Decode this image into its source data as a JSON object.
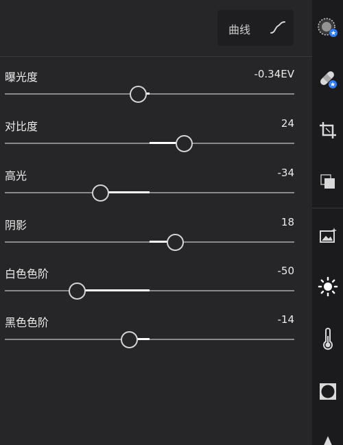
{
  "header": {
    "curve_label": "曲线"
  },
  "sliders": [
    {
      "label": "曝光度",
      "value": "-0.34EV",
      "position": 0.46,
      "center": 0.5
    },
    {
      "label": "对比度",
      "value": "24",
      "position": 0.62,
      "center": 0.5
    },
    {
      "label": "高光",
      "value": "-34",
      "position": 0.33,
      "center": 0.5
    },
    {
      "label": "阴影",
      "value": "18",
      "position": 0.59,
      "center": 0.5
    },
    {
      "label": "白色色阶",
      "value": "-50",
      "position": 0.25,
      "center": 0.5
    },
    {
      "label": "黑色色阶",
      "value": "-14",
      "position": 0.43,
      "center": 0.5
    }
  ],
  "toolbar": {
    "items": [
      {
        "name": "auto-edit-icon"
      },
      {
        "name": "healing-icon"
      },
      {
        "name": "crop-icon"
      },
      {
        "name": "layers-icon"
      },
      {
        "name": "presets-icon"
      },
      {
        "name": "light-icon",
        "active": true
      },
      {
        "name": "color-temperature-icon"
      },
      {
        "name": "vignette-icon"
      },
      {
        "name": "detail-icon"
      }
    ]
  },
  "colors": {
    "panel_bg": "#262628",
    "toolbar_bg": "#1b1b1d",
    "badge_blue": "#2f7cf6",
    "text": "#ececec"
  }
}
